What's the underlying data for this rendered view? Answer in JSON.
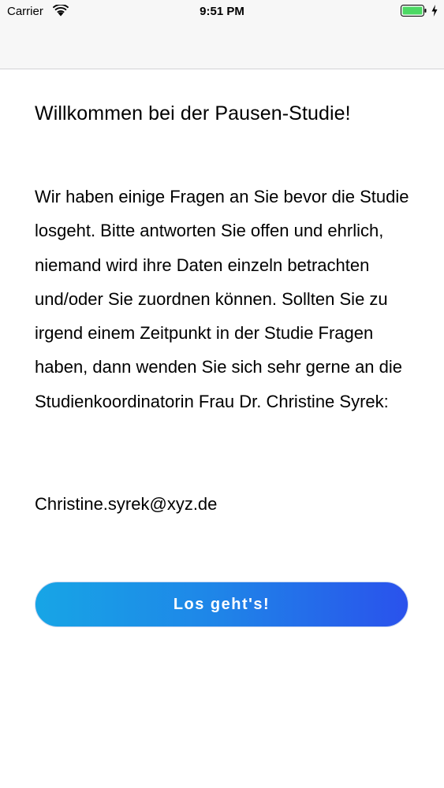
{
  "status_bar": {
    "carrier": "Carrier",
    "time": "9:51 PM",
    "icons": [
      "wifi-icon",
      "battery-icon",
      "charging-bolt-icon"
    ]
  },
  "content": {
    "title": "Willkommen bei der Pausen-Studie!",
    "body": "Wir haben einige Fragen an Sie bevor die Studie losgeht. Bitte antworten Sie offen und ehrlich, niemand wird ihre Daten einzeln betrachten und/oder Sie zuordnen können. Sollten Sie zu irgend einem Zeitpunkt in der Studie Fragen haben, dann wenden Sie sich sehr gerne an die Studienkoordinatorin Frau Dr. Christine Syrek:",
    "email": "Christine.syrek@xyz.de"
  },
  "actions": {
    "start_label": "Los geht's!"
  },
  "colors": {
    "button_gradient_start": "#17a5e6",
    "button_gradient_end": "#2a52ec",
    "battery": "#4cd964",
    "bar_background": "#f7f7f7"
  }
}
